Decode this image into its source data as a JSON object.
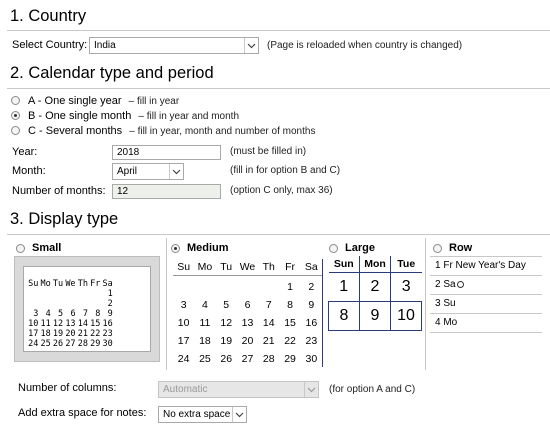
{
  "section1": {
    "heading": "1. Country",
    "select_label": "Select Country:",
    "country_value": "India",
    "note": "(Page is reloaded when country is changed)"
  },
  "section2": {
    "heading": "2. Calendar type and period",
    "options": [
      {
        "letter": "A",
        "title": "One single year",
        "hint": "– fill in year",
        "selected": false
      },
      {
        "letter": "B",
        "title": "One single month",
        "hint": "– fill in year and month",
        "selected": true
      },
      {
        "letter": "C",
        "title": "Several months",
        "hint": "– fill in year, month and number of months",
        "selected": false
      }
    ],
    "year": {
      "label": "Year:",
      "value": "2018",
      "note": "(must be filled in)"
    },
    "month": {
      "label": "Month:",
      "value": "April",
      "note": "(fill in for option B and C)"
    },
    "num_months": {
      "label": "Number of months:",
      "value": "12",
      "note": "(option C only, max 36)"
    }
  },
  "section3": {
    "heading": "3. Display type",
    "small": {
      "label": "Small",
      "selected": false,
      "header": [
        "Su",
        "Mo",
        "Tu",
        "We",
        "Th",
        "Fr",
        "Sa"
      ],
      "weeks": [
        [
          "",
          "",
          "",
          "",
          "",
          "",
          "1"
        ],
        [
          "",
          "",
          "",
          "",
          "",
          "",
          "2"
        ],
        [
          "3",
          "4",
          "5",
          "6",
          "7",
          "8",
          "9"
        ],
        [
          "10",
          "11",
          "12",
          "13",
          "14",
          "15",
          "16"
        ],
        [
          "17",
          "18",
          "19",
          "20",
          "21",
          "22",
          "23"
        ],
        [
          "24",
          "25",
          "26",
          "27",
          "28",
          "29",
          "30"
        ]
      ]
    },
    "medium": {
      "label": "Medium",
      "selected": true,
      "header": [
        "Su",
        "Mo",
        "Tu",
        "We",
        "Th",
        "Fr",
        "Sa"
      ],
      "weeks": [
        [
          "",
          "",
          "",
          "",
          "",
          "1",
          "2"
        ],
        [
          "3",
          "4",
          "5",
          "6",
          "7",
          "8",
          "9"
        ],
        [
          "10",
          "11",
          "12",
          "13",
          "14",
          "15",
          "16"
        ],
        [
          "17",
          "18",
          "19",
          "20",
          "21",
          "22",
          "23"
        ],
        [
          "24",
          "25",
          "26",
          "27",
          "28",
          "29",
          "30"
        ]
      ]
    },
    "large": {
      "label": "Large",
      "selected": false,
      "header": [
        "Sun",
        "Mon",
        "Tue"
      ],
      "rows": [
        [
          "1",
          "2",
          "3"
        ],
        [
          "8",
          "9",
          "10"
        ]
      ]
    },
    "row": {
      "label": "Row",
      "selected": false,
      "items": [
        "1 Fr New Year's Day",
        "2 Sa",
        "3 Su",
        "4 Mo"
      ]
    },
    "columns": {
      "label": "Number of columns:",
      "value": "Automatic",
      "note": "(for option A and C)"
    },
    "notes": {
      "label": "Add extra space for notes:",
      "value": "No extra space"
    }
  },
  "icons": {
    "dropdown": "chevron-down-icon",
    "radio": "radio-icon"
  }
}
